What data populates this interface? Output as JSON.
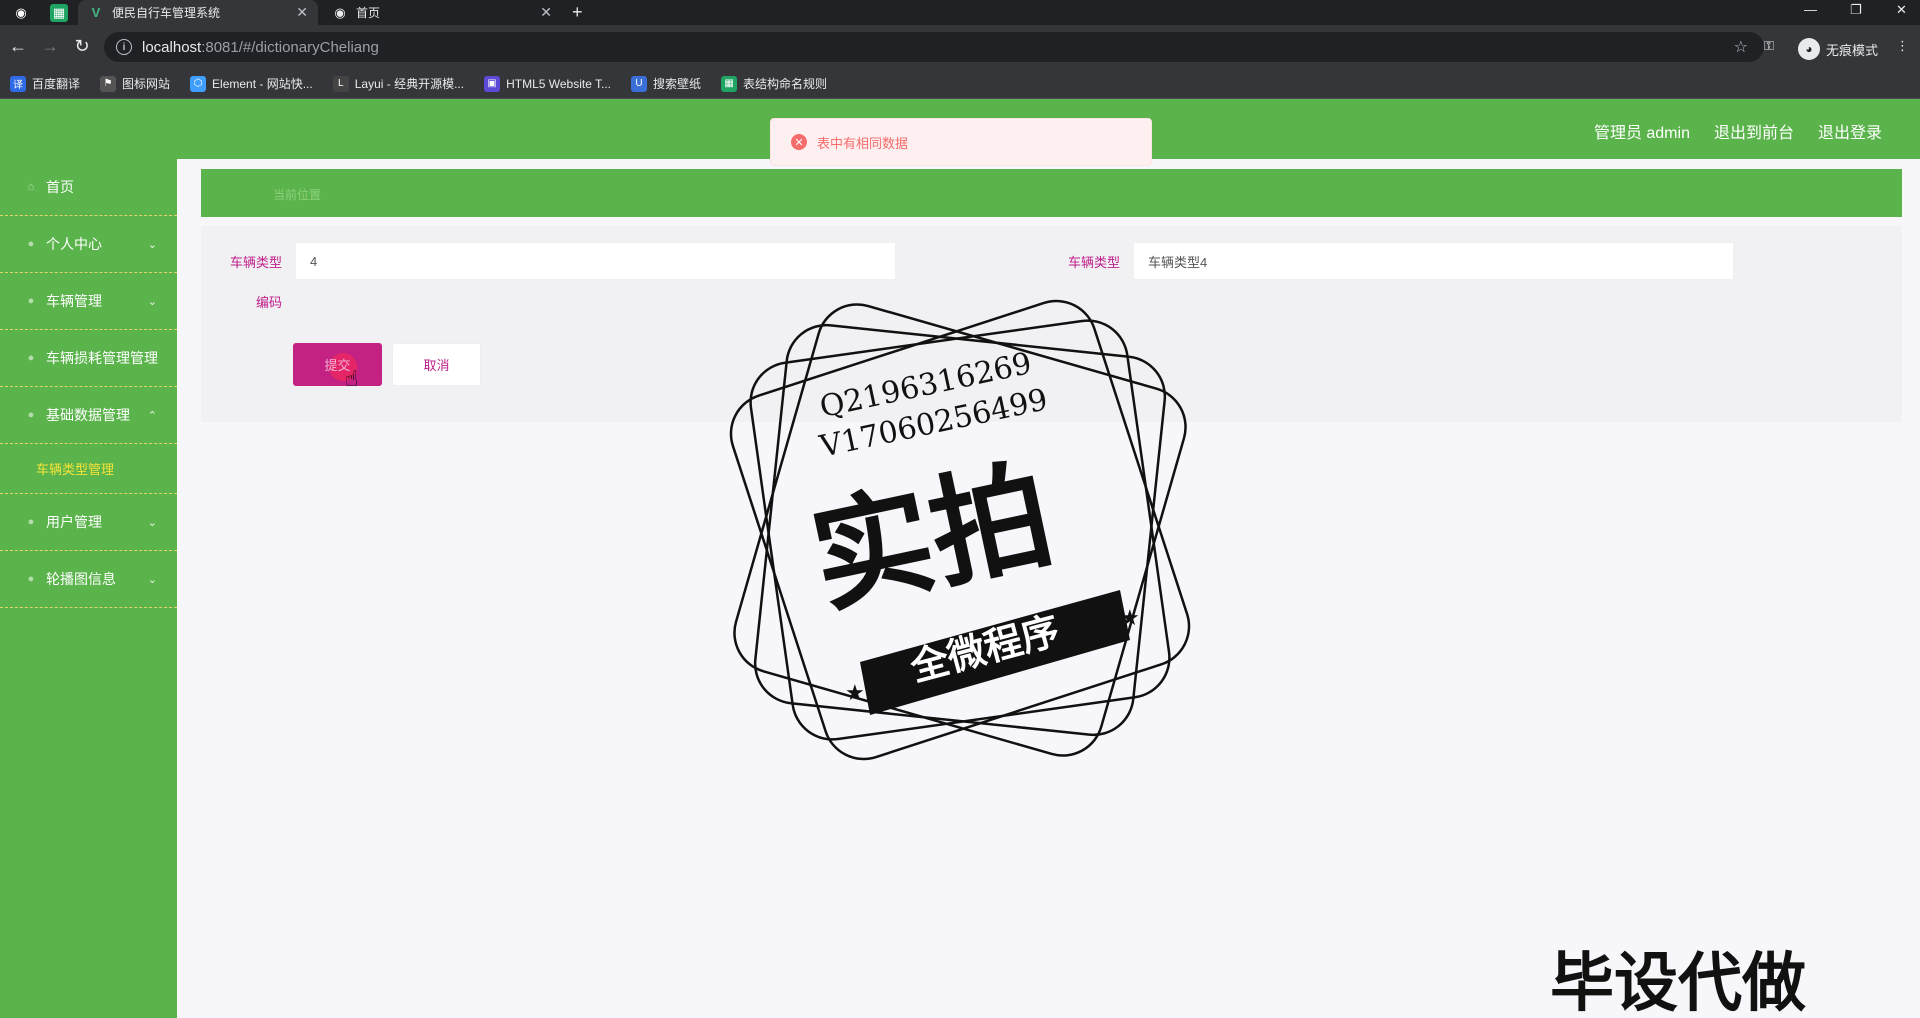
{
  "browser": {
    "tabs": [
      {
        "title": "便民自行车管理系统",
        "active": true
      },
      {
        "title": "首页",
        "active": false
      }
    ],
    "new_tab": "+",
    "address": {
      "host": "localhost",
      "path": ":8081/#/dictionaryCheliang"
    },
    "incognito_label": "无痕模式",
    "bookmarks": [
      {
        "label": "百度翻译",
        "color": "#2f6be6"
      },
      {
        "label": "图标网站",
        "color": "#333333"
      },
      {
        "label": "Element - 网站快...",
        "color": "#409eff"
      },
      {
        "label": "Layui - 经典开源模...",
        "color": "#444444"
      },
      {
        "label": "HTML5 Website T...",
        "color": "#5b4bd6"
      },
      {
        "label": "搜索壁纸",
        "color": "#3a6fd8"
      },
      {
        "label": "表结构命名规则",
        "color": "#1fa463"
      }
    ]
  },
  "header": {
    "links": [
      "管理员 admin",
      "退出到前台",
      "退出登录"
    ]
  },
  "alert": {
    "message": "表中有相同数据"
  },
  "sidebar": {
    "items": [
      {
        "label": "首页",
        "chevron": ""
      },
      {
        "label": "个人中心",
        "chevron": "⌄"
      },
      {
        "label": "车辆管理",
        "chevron": "⌄"
      },
      {
        "label": "车辆损耗管理管理",
        "chevron": ""
      },
      {
        "label": "基础数据管理",
        "chevron": "⌃"
      },
      {
        "label": "用户管理",
        "chevron": "⌄"
      },
      {
        "label": "轮播图信息",
        "chevron": "⌄"
      }
    ],
    "sub_item": "车辆类型管理"
  },
  "breadcrumb": "当前位置",
  "form": {
    "field1_label_a": "车辆类型",
    "field1_label_b": "编码",
    "field1_value": "4",
    "field2_label": "车辆类型",
    "field2_value": "车辆类型4",
    "submit_label": "提交",
    "cancel_label": "取消"
  },
  "watermark": {
    "line1": "Q2196316269",
    "line2": "V17060256499",
    "big": "实拍",
    "ribbon": "全微程序",
    "bottom": "毕设代做"
  },
  "colors": {
    "brand_green": "#5ab44b",
    "accent_magenta": "#c42283",
    "error": "#f56c6c"
  }
}
